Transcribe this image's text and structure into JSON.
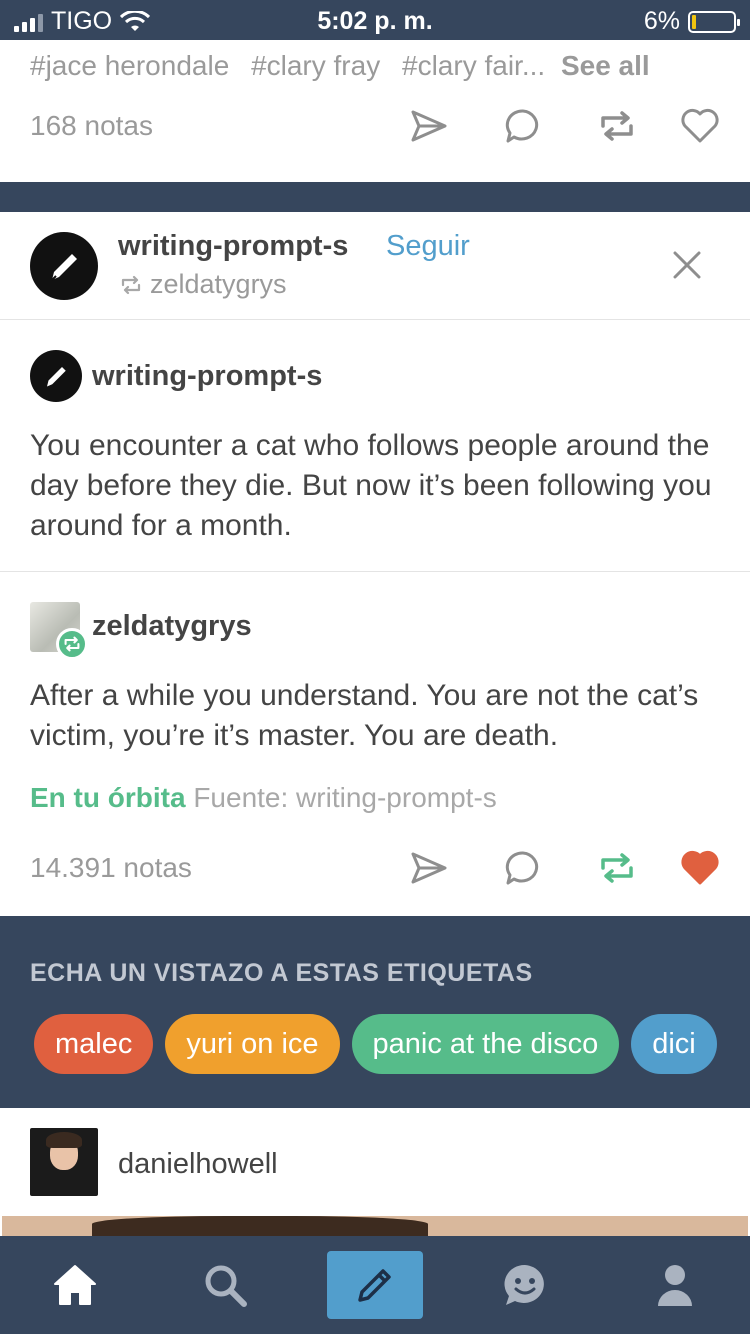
{
  "status_bar": {
    "carrier": "TIGO",
    "time": "5:02 p. m.",
    "battery": "6%"
  },
  "previous_post": {
    "tags": [
      "#jace herondale",
      "#clary fray",
      "#clary fair..."
    ],
    "see_all": "See all",
    "notes": "168 notas"
  },
  "post": {
    "blog": "writing-prompt-s",
    "follow_label": "Seguir",
    "reblogged_via": "zeldatygrys",
    "trail": [
      {
        "name": "writing-prompt-s",
        "body": "You encounter a cat who follows people around the day before they die. But now it’s been following you around for a month."
      },
      {
        "name": "zeldatygrys",
        "body": "After a while you understand. You are not the cat’s victim, you’re it’s master. You are death."
      }
    ],
    "orbit_label": "En tu órbita",
    "source_label": "Fuente: writing-prompt-s",
    "notes": "14.391 notas",
    "liked": true
  },
  "explore": {
    "title": "ECHA UN VISTAZO A ESTAS ETIQUETAS",
    "tags": [
      {
        "label": "malec",
        "color": "#e0603f"
      },
      {
        "label": "yuri on ice",
        "color": "#f0a02d"
      },
      {
        "label": "panic at the disco",
        "color": "#56bc8a"
      },
      {
        "label": "dici",
        "color": "#529ecc"
      }
    ]
  },
  "next_post": {
    "blog": "danielhowell"
  },
  "colors": {
    "navy": "#36465d",
    "link_blue": "#529ecc",
    "green": "#56bc8a",
    "like_red": "#e0603f"
  },
  "tab_bar": {
    "icons": [
      "home-icon",
      "search-icon",
      "compose-icon",
      "messaging-icon",
      "account-icon"
    ]
  }
}
